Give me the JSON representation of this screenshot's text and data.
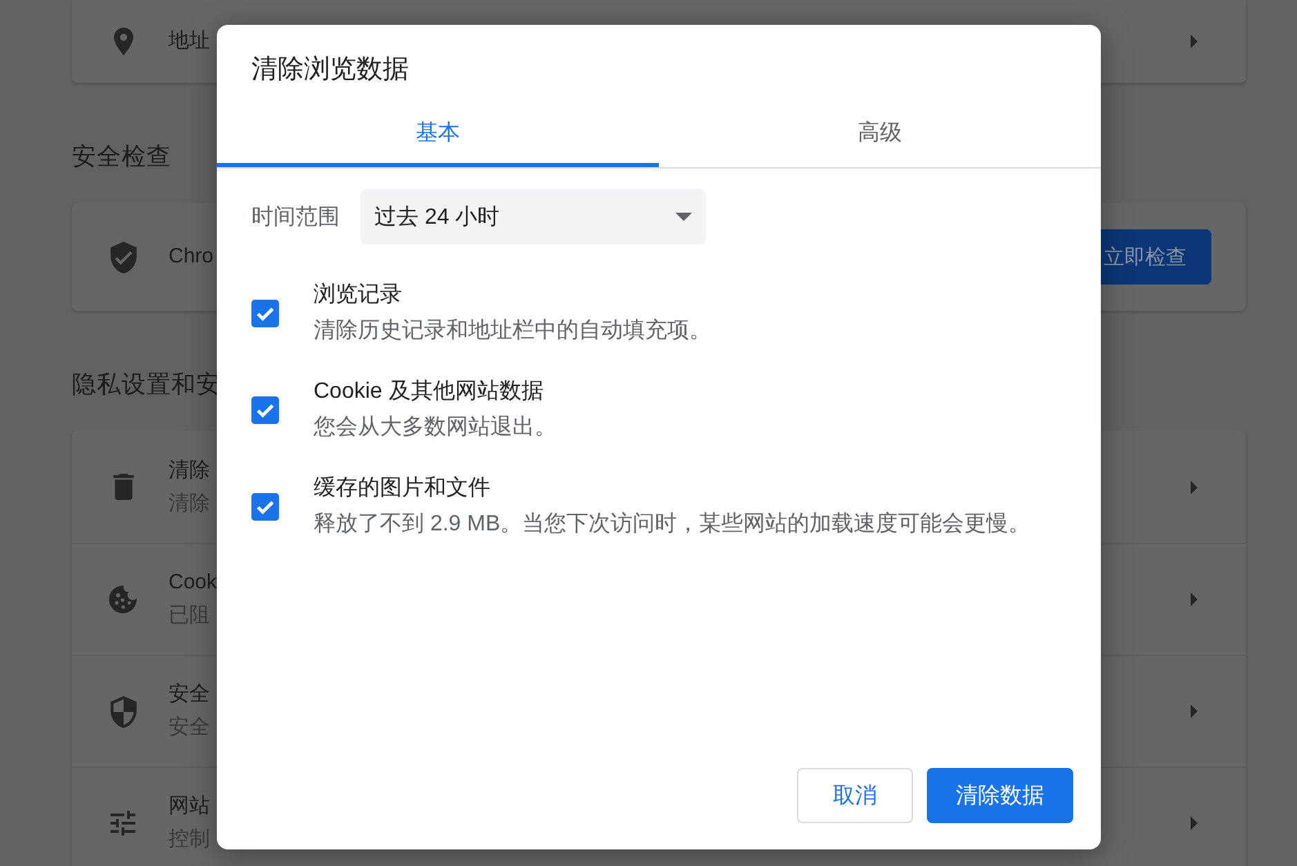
{
  "settings_page": {
    "sections": [
      {
        "rows": [
          {
            "title": "地址"
          }
        ]
      },
      {
        "heading": "安全检查",
        "rows": [
          {
            "title": "Chro",
            "button": "立即检查"
          }
        ]
      },
      {
        "heading": "隐私设置和安",
        "rows": [
          {
            "title": "清除",
            "subtitle": "清除"
          },
          {
            "title": "Cook",
            "subtitle": "已阻"
          },
          {
            "title": "安全",
            "subtitle": "安全"
          },
          {
            "title": "网站",
            "subtitle": "控制"
          }
        ]
      }
    ]
  },
  "dialog": {
    "title": "清除浏览数据",
    "tabs": [
      {
        "label": "基本",
        "selected": true
      },
      {
        "label": "高级",
        "selected": false
      }
    ],
    "time_range": {
      "label": "时间范围",
      "value": "过去 24 小时"
    },
    "options": [
      {
        "label": "浏览记录",
        "description": "清除历史记录和地址栏中的自动填充项。",
        "checked": true
      },
      {
        "label": "Cookie 及其他网站数据",
        "description": "您会从大多数网站退出。",
        "checked": true
      },
      {
        "label": "缓存的图片和文件",
        "description": "释放了不到 2.9 MB。当您下次访问时，某些网站的加载速度可能会更慢。",
        "checked": true
      }
    ],
    "buttons": [
      {
        "label": "取消",
        "kind": "secondary"
      },
      {
        "label": "清除数据",
        "kind": "primary"
      }
    ]
  }
}
